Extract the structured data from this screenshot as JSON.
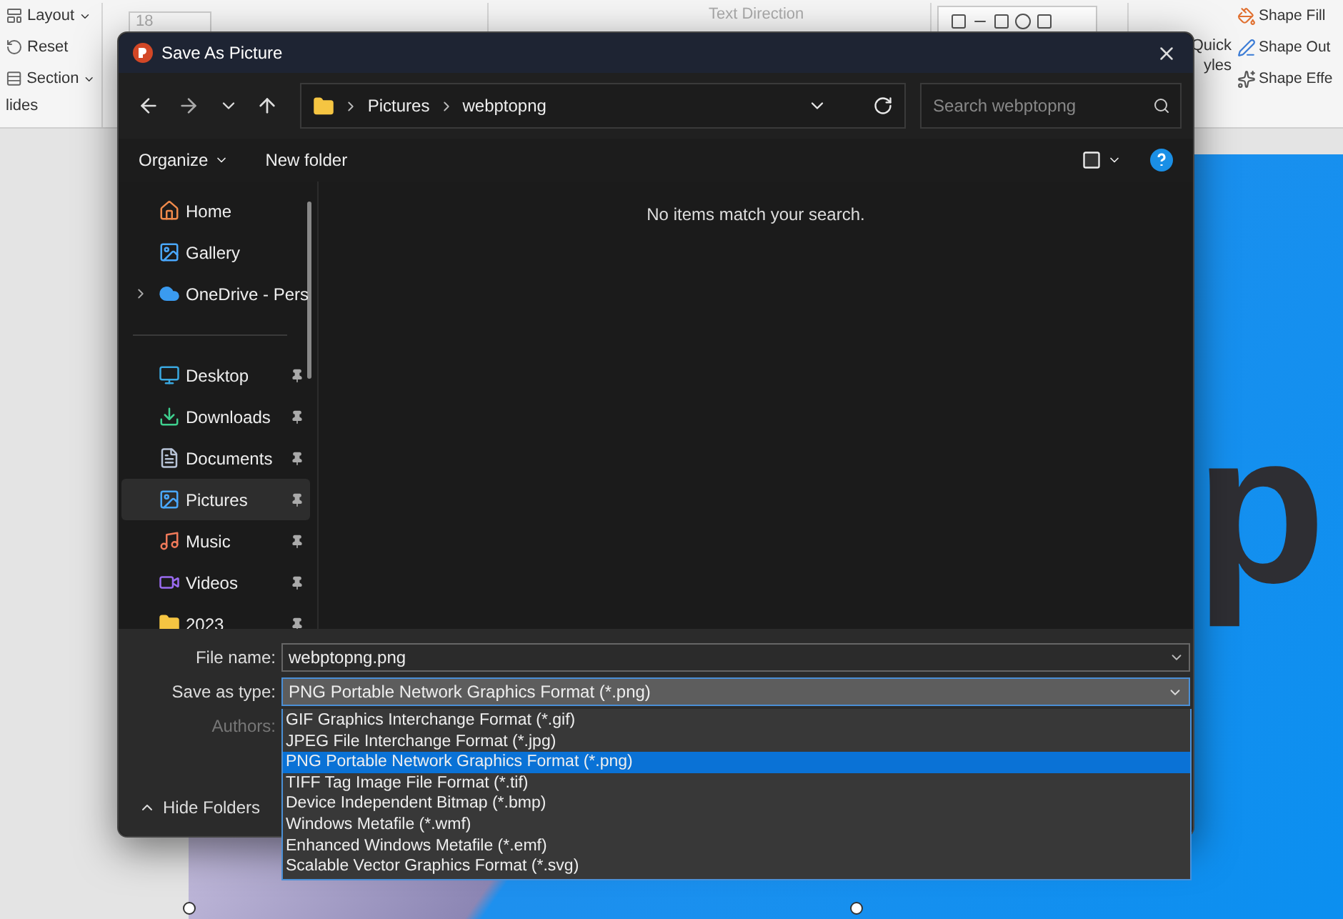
{
  "ribbon": {
    "slides_group": [
      {
        "label": "Layout",
        "dropdown": true
      },
      {
        "label": "Reset",
        "dropdown": false
      },
      {
        "label": "Section",
        "dropdown": true
      }
    ],
    "slides_group_label": "lides",
    "font_size": "18",
    "text_direction": "Text Direction",
    "quick_styles": [
      "Quick",
      "yles"
    ],
    "shape_commands": [
      "Shape Fill",
      "Shape Out",
      "Shape Effe"
    ]
  },
  "slide": {
    "text": "p"
  },
  "dialog": {
    "title": "Save As Picture",
    "breadcrumb": [
      "Pictures",
      "webptopng"
    ],
    "search": {
      "placeholder": "Search webptopng"
    },
    "toolbar": {
      "organize": "Organize",
      "new_folder": "New folder"
    },
    "sidebar": {
      "top_items": [
        {
          "label": "Home"
        },
        {
          "label": "Gallery"
        },
        {
          "label": "OneDrive - Pers",
          "expanded": false
        }
      ],
      "pinned_items": [
        {
          "label": "Desktop",
          "selected": false
        },
        {
          "label": "Downloads",
          "selected": false
        },
        {
          "label": "Documents",
          "selected": false
        },
        {
          "label": "Pictures",
          "selected": true
        },
        {
          "label": "Music",
          "selected": false
        },
        {
          "label": "Videos",
          "selected": false
        },
        {
          "label": "2023",
          "selected": false
        }
      ]
    },
    "empty_message": "No items match your search.",
    "file_name": {
      "label": "File name:",
      "value": "webptopng.png"
    },
    "save_as_type": {
      "label": "Save as type:",
      "value": "PNG Portable Network Graphics Format (*.png)",
      "expanded": true,
      "options": [
        {
          "label": "GIF Graphics Interchange Format (*.gif)",
          "selected": false
        },
        {
          "label": "JPEG File Interchange Format (*.jpg)",
          "selected": false
        },
        {
          "label": "PNG Portable Network Graphics Format (*.png)",
          "selected": true
        },
        {
          "label": "TIFF Tag Image File Format (*.tif)",
          "selected": false
        },
        {
          "label": "Device Independent Bitmap (*.bmp)",
          "selected": false
        },
        {
          "label": "Windows Metafile (*.wmf)",
          "selected": false
        },
        {
          "label": "Enhanced Windows Metafile (*.emf)",
          "selected": false
        },
        {
          "label": "Scalable Vector Graphics Format (*.svg)",
          "selected": false
        }
      ]
    },
    "authors_label": "Authors:",
    "hide_folders": "Hide Folders"
  }
}
